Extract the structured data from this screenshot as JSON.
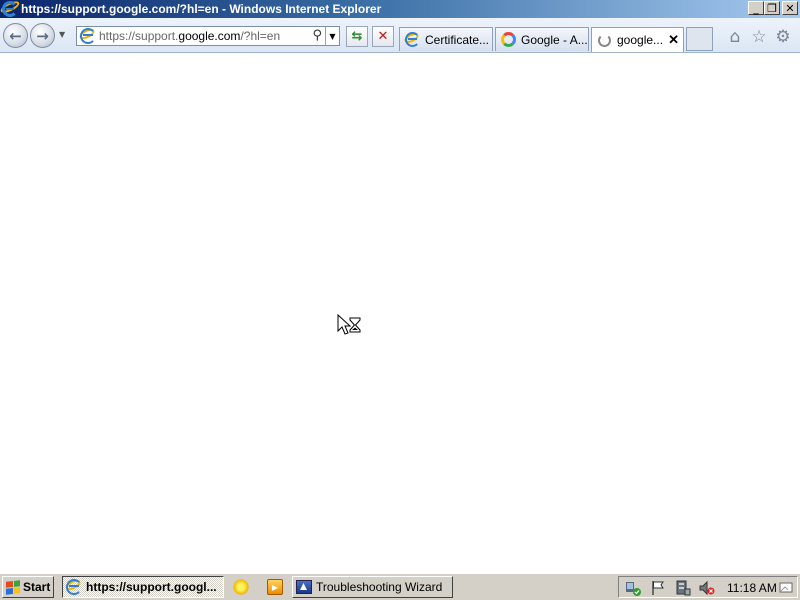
{
  "window": {
    "title": "https://support.google.com/?hl=en - Windows Internet Explorer",
    "app_icon": "ie-logo-icon",
    "controls": {
      "minimize": "_",
      "maximize": "❐",
      "close": "✕"
    }
  },
  "toolbar": {
    "back_icon": "back-arrow-icon",
    "forward_icon": "forward-arrow-icon",
    "recent_pages_icon": "chevron-down-icon",
    "address": {
      "prefix": "https://support.",
      "domain": "google.com",
      "suffix": "/?hl=en"
    },
    "search_icon": "⚲",
    "dropdown_icon": "▼",
    "refresh_icon": "⇆",
    "stop_icon": "✕"
  },
  "tabs": [
    {
      "label": "Certificate...",
      "icon": "ie-page-icon",
      "active": false
    },
    {
      "label": "Google - A...",
      "icon": "google-g-icon",
      "active": false
    },
    {
      "label": "google...",
      "icon": "loading-spinner-icon",
      "active": true,
      "close": "✕"
    }
  ],
  "right_tools": {
    "home": "⌂",
    "favorites": "☆",
    "tools": "⚙"
  },
  "taskbar": {
    "start_label": "Start",
    "start_colors": [
      "#e34b1c",
      "#3ba53b",
      "#2a6fd8",
      "#f6c21a"
    ],
    "tasks": [
      {
        "label": "https://support.googl...",
        "icon": "ie-logo-icon",
        "active": true
      },
      {
        "label": "Troubleshooting Wizard",
        "icon": "wizard-icon",
        "active": false
      }
    ],
    "quick_launch": [
      "sun-icon",
      "media-player-icon"
    ],
    "tray_icons": [
      "network-icon",
      "action-center-flag-icon",
      "computer-icon",
      "volume-muted-icon"
    ],
    "clock": "11:18 AM"
  }
}
